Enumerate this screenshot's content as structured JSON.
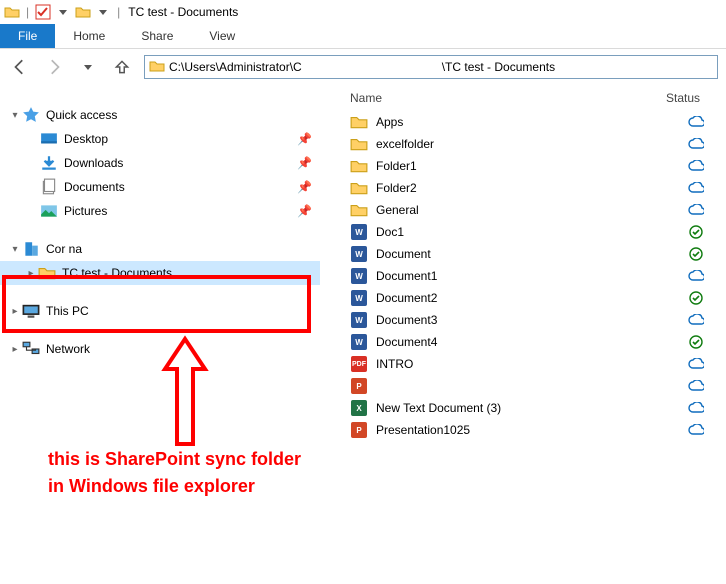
{
  "titlebar": {
    "title": "TC test - Documents"
  },
  "ribbon": {
    "file": "File",
    "tabs": [
      "Home",
      "Share",
      "View"
    ]
  },
  "address": {
    "path": "C:\\Users\\Administrator\\C                                          \\TC test - Documents"
  },
  "navpane": {
    "quick_access": {
      "label": "Quick access",
      "items": [
        {
          "label": "Desktop",
          "icon": "desktop"
        },
        {
          "label": "Downloads",
          "icon": "downloads"
        },
        {
          "label": "Documents",
          "icon": "documents"
        },
        {
          "label": "Pictures",
          "icon": "pictures"
        }
      ]
    },
    "sharepoint": {
      "label": "Cor                               na",
      "items": [
        {
          "label": "TC test - Documents"
        }
      ]
    },
    "this_pc": {
      "label": "This PC"
    },
    "network": {
      "label": "Network"
    }
  },
  "columns": {
    "name": "Name",
    "status": "Status"
  },
  "files": [
    {
      "name": "Apps",
      "type": "folder",
      "status": "cloud"
    },
    {
      "name": "excelfolder",
      "type": "folder",
      "status": "cloud"
    },
    {
      "name": "Folder1",
      "type": "folder",
      "status": "cloud"
    },
    {
      "name": "Folder2",
      "type": "folder",
      "status": "cloud"
    },
    {
      "name": "General",
      "type": "folder",
      "status": "cloud"
    },
    {
      "name": "Doc1",
      "type": "word",
      "status": "synced"
    },
    {
      "name": "Document",
      "type": "word",
      "status": "synced"
    },
    {
      "name": "Document1",
      "type": "word",
      "status": "cloud"
    },
    {
      "name": "Document2",
      "type": "word",
      "status": "synced"
    },
    {
      "name": "Document3",
      "type": "word",
      "status": "cloud"
    },
    {
      "name": "Document4",
      "type": "word",
      "status": "synced"
    },
    {
      "name": "INTRO",
      "type": "pdf",
      "status": "cloud"
    },
    {
      "name": "",
      "type": "ppt",
      "status": "cloud"
    },
    {
      "name": "New Text Document (3)",
      "type": "excel",
      "status": "cloud"
    },
    {
      "name": "Presentation1025",
      "type": "ppt",
      "status": "cloud"
    }
  ],
  "annotation": {
    "text": "this is SharePoint sync folder in Windows file explorer"
  }
}
